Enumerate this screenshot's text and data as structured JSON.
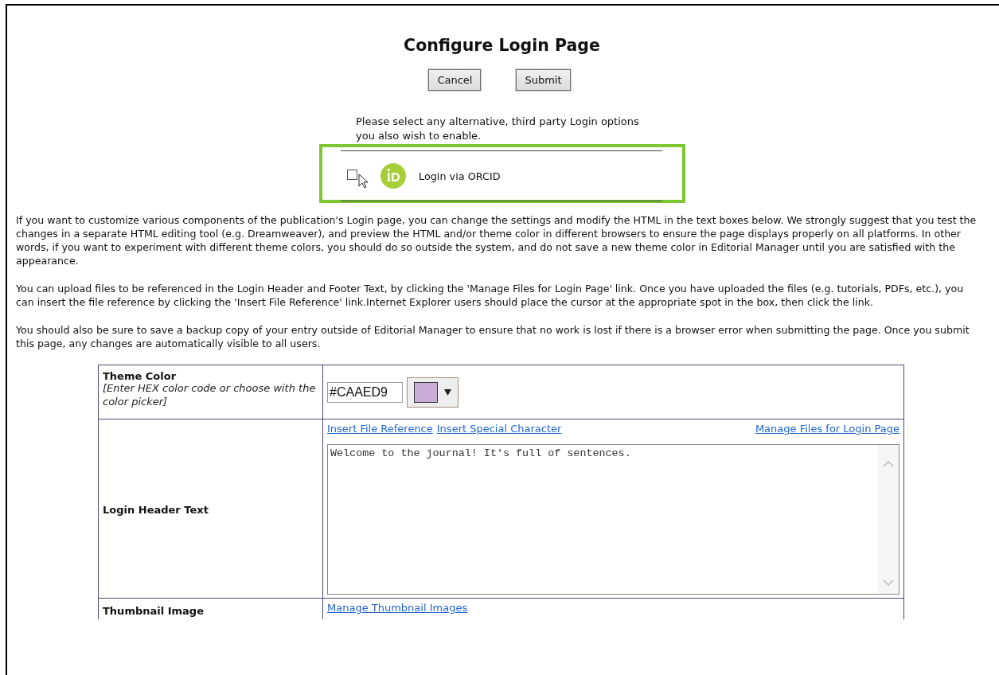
{
  "title": "Configure Login Page",
  "buttons": [
    {
      "label": "Cancel"
    },
    {
      "label": "Submit"
    }
  ],
  "login_options": {
    "prompt": "Please select any alternative, third party Login options you also wish to enable.",
    "options": [
      {
        "label": "Login via ORCID",
        "checked": false
      }
    ]
  },
  "paragraphs": [
    "If you want to customize various components of the publication's Login page, you can change the settings and modify the HTML in the text boxes below. We strongly suggest that you test the changes in a separate HTML editing tool (e.g. Dreamweaver), and preview the HTML and/or theme color in different browsers to ensure the page displays properly on all platforms. In other words, if you want to experiment with different theme colors, you should do so outside the system, and do not save a new theme color in Editorial Manager until you are satisfied with the appearance.",
    "You can upload files to be referenced in the Login Header and Footer Text, by clicking the 'Manage Files for Login Page' link. Once you have uploaded the files (e.g. tutorials, PDFs, etc.), you can insert the file reference by clicking the 'Insert File Reference' link.Internet Explorer users should place the cursor at the appropriate spot in the box, then click the link.",
    "You should also be sure to save a backup copy of your entry outside of Editorial Manager to ensure that no work is lost if there is a browser error when submitting the page. Once you submit this page, any changes are automatically visible to all users."
  ],
  "settings_table": {
    "rows": [
      {
        "kind": "color",
        "label": "Theme Color",
        "hint": "[Enter HEX color code or choose with the color picker]",
        "value": "#CAAED9"
      },
      {
        "kind": "editor",
        "label": "Login Header Text",
        "left_links": [
          "Insert File Reference",
          "Insert Special Character"
        ],
        "right_links": [
          "Manage Files for Login Page"
        ],
        "value": "Welcome to the journal! It's full of sentences."
      },
      {
        "kind": "links",
        "label": "Thumbnail Image",
        "left_links": [
          "Manage Thumbnail Images"
        ]
      }
    ]
  }
}
